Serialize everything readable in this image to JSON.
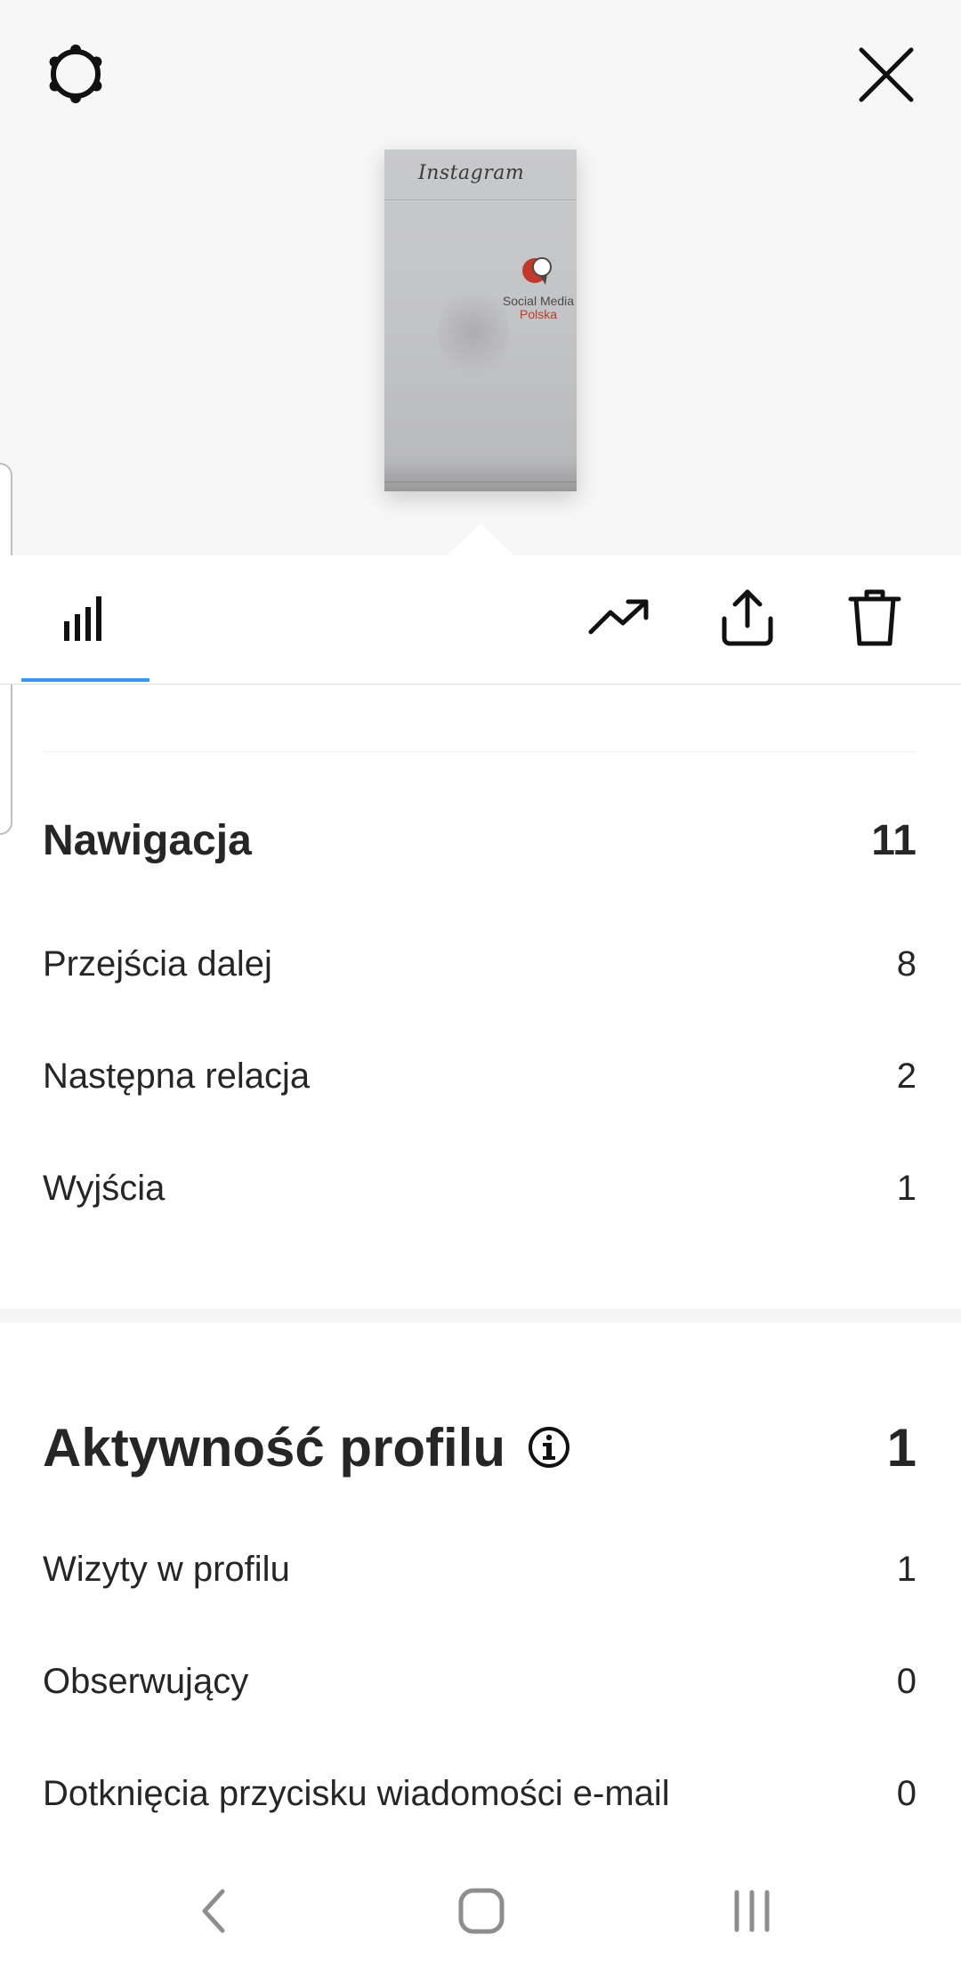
{
  "story_preview": {
    "instagram_wordmark": "Instagram",
    "logo_line1": "Social Media",
    "logo_line2": "Polska"
  },
  "navigation": {
    "title": "Nawigacja",
    "total": "11",
    "rows": [
      {
        "label": "Przejścia dalej",
        "value": "8"
      },
      {
        "label": "Następna relacja",
        "value": "2"
      },
      {
        "label": "Wyjścia",
        "value": "1"
      }
    ]
  },
  "profile_activity": {
    "title": "Aktywność profilu",
    "total": "1",
    "rows": [
      {
        "label": "Wizyty w profilu",
        "value": "1"
      },
      {
        "label": "Obserwujący",
        "value": "0"
      },
      {
        "label": "Dotknięcia przycisku wiadomości e-mail",
        "value": "0"
      }
    ]
  },
  "colors": {
    "accent": "#3897f0",
    "text": "#262626",
    "top_background": "#f7f7f8"
  },
  "icons": {
    "settings": "settings-icon",
    "close": "close-icon",
    "insights": "bar-chart-icon",
    "promote": "trending-up-icon",
    "share": "share-icon",
    "delete": "trash-icon",
    "info": "info-icon",
    "back": "back-icon",
    "home": "home-icon",
    "recents": "recents-icon"
  }
}
